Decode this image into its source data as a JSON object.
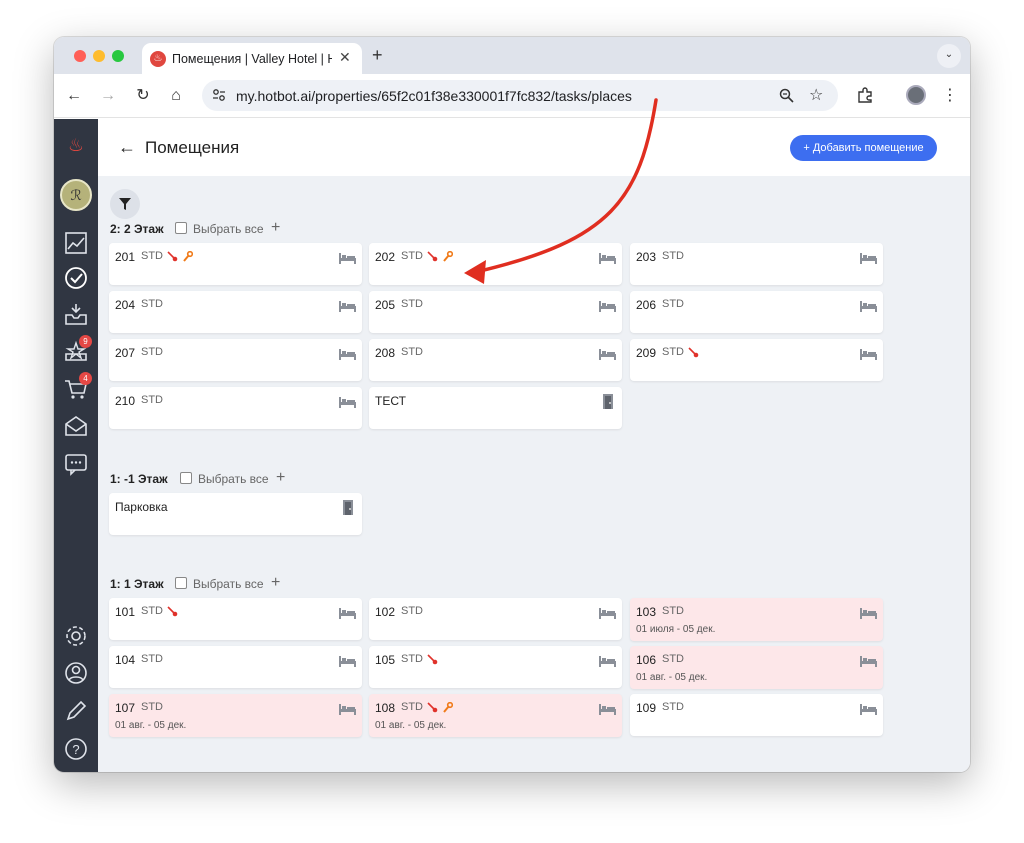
{
  "browser": {
    "tab_title": "Помещения | Valley Hotel | HotBot",
    "tab_close": "✕",
    "new_tab": "+",
    "url": "my.hotbot.ai/properties/65f2c01f38e330001f7fc832/tasks/places"
  },
  "sidebar": {
    "badges": {
      "favorites": "9",
      "cart": "4"
    }
  },
  "page": {
    "back_icon": "←",
    "title": "Помещения",
    "add_button": "+ Добавить помещение"
  },
  "select_all_label": "Выбрать все",
  "floors": [
    {
      "name": "2: 2 Этаж",
      "rooms": [
        {
          "num": "201",
          "type": "STD",
          "icons": [
            "broom",
            "wrench"
          ]
        },
        {
          "num": "202",
          "type": "STD",
          "icons": [
            "broom",
            "wrench"
          ]
        },
        {
          "num": "203",
          "type": "STD",
          "icons": []
        },
        {
          "num": "204",
          "type": "STD",
          "icons": []
        },
        {
          "num": "205",
          "type": "STD",
          "icons": []
        },
        {
          "num": "206",
          "type": "STD",
          "icons": []
        },
        {
          "num": "207",
          "type": "STD",
          "icons": []
        },
        {
          "num": "208",
          "type": "STD",
          "icons": []
        },
        {
          "num": "209",
          "type": "STD",
          "icons": [
            "broom"
          ]
        },
        {
          "num": "210",
          "type": "STD",
          "icons": []
        },
        {
          "num": "ТЕСТ",
          "type": "",
          "icons": [],
          "kind": "door"
        }
      ]
    },
    {
      "name": "1: -1 Этаж",
      "rooms": [
        {
          "num": "Парковка",
          "type": "",
          "icons": [],
          "kind": "door"
        }
      ]
    },
    {
      "name": "1: 1 Этаж",
      "rooms": [
        {
          "num": "101",
          "type": "STD",
          "icons": [
            "broom"
          ]
        },
        {
          "num": "102",
          "type": "STD",
          "icons": []
        },
        {
          "num": "103",
          "type": "STD",
          "icons": [],
          "dates": "01 июля - 05 дек."
        },
        {
          "num": "104",
          "type": "STD",
          "icons": []
        },
        {
          "num": "105",
          "type": "STD",
          "icons": [
            "broom"
          ]
        },
        {
          "num": "106",
          "type": "STD",
          "icons": [],
          "dates": "01 авг. - 05 дек."
        },
        {
          "num": "107",
          "type": "STD",
          "icons": [],
          "dates": "01 авг. - 05 дек."
        },
        {
          "num": "108",
          "type": "STD",
          "icons": [
            "broom",
            "wrench"
          ],
          "dates": "01 авг. - 05 дек."
        },
        {
          "num": "109",
          "type": "STD",
          "icons": []
        }
      ]
    }
  ],
  "colors": {
    "accent": "#3d6ef0",
    "sidebar": "#303642",
    "occupied": "#fde7e9",
    "broom": "#e0322b",
    "wrench": "#f07b1a",
    "arrow": "#e02e20"
  }
}
